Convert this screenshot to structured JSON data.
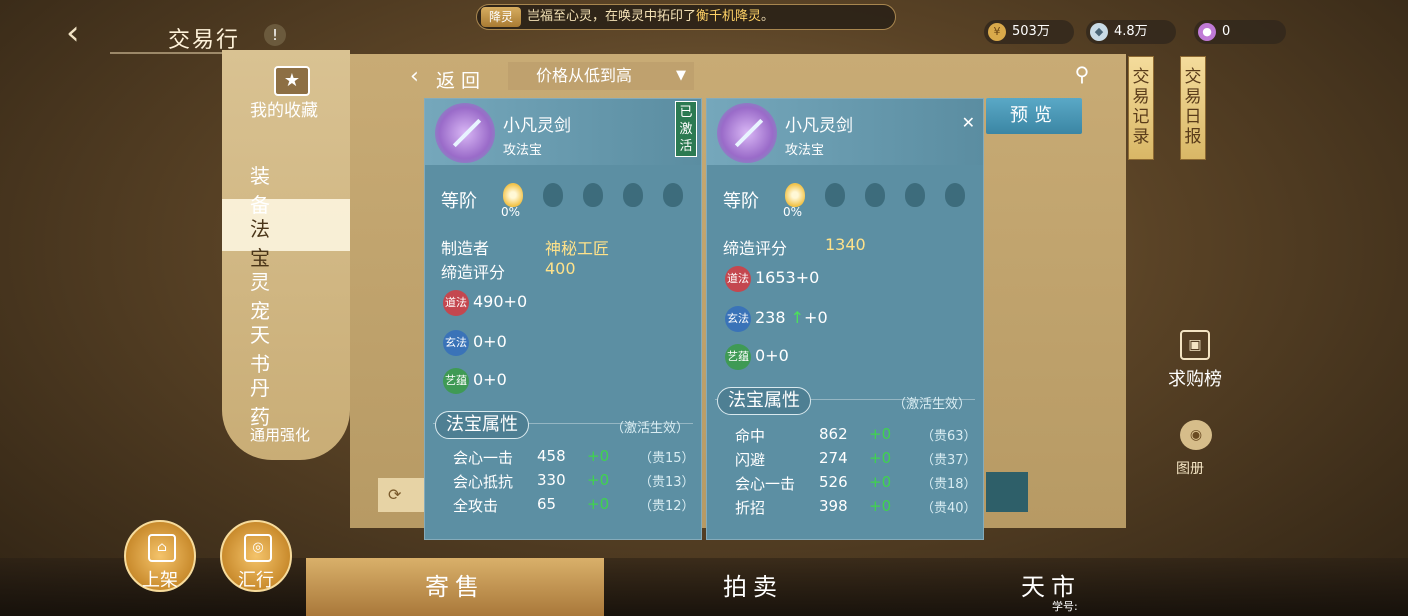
{
  "header": {
    "title": "交易行",
    "badge": "!",
    "ticker_tag": "降灵",
    "ticker_text_a": "岂福至心灵，在唤灵中拓印了",
    "ticker_highlight": "衡千机降灵",
    "ticker_text_b": "。",
    "currencies": [
      {
        "icon": "gold-coin-icon",
        "value": "503万"
      },
      {
        "icon": "silver-ingot-icon",
        "value": "4.8万"
      },
      {
        "icon": "spirit-orb-icon",
        "value": "0"
      }
    ]
  },
  "sidebar": {
    "favorites": "我的收藏",
    "categories": [
      "装备",
      "法宝",
      "灵宠",
      "天书",
      "丹药"
    ],
    "active_category": "法宝",
    "more": "通用强化"
  },
  "toolbar": {
    "back": "返回",
    "sort_value": "价格从低到高",
    "preview": "预览",
    "trade_records": "交易记录",
    "trade_daily": "交易日报"
  },
  "side_actions": {
    "wanted": "求购榜",
    "partial_label": "图册"
  },
  "cards": [
    {
      "name": "小凡灵剑",
      "type": "攻法宝",
      "activated": "已激活",
      "grade_label": "等阶",
      "grade_pct": "0%",
      "info": [
        {
          "k": "制造者",
          "v": "神秘工匠"
        },
        {
          "k": "缔造评分",
          "v": "400"
        }
      ],
      "stats": [
        {
          "gem": "道法",
          "value": "490+0",
          "color": "#c4474f"
        },
        {
          "gem": "玄法",
          "value": "0+0",
          "color": "#3a73b8"
        },
        {
          "gem": "艺蕴",
          "value": "0+0",
          "color": "#3f9a55"
        }
      ],
      "prop_title": "法宝属性",
      "prop_note": "（激活生效）",
      "props": [
        {
          "n": "会心一击",
          "v": "458",
          "b": "+0",
          "p": "（贵15）"
        },
        {
          "n": "会心抵抗",
          "v": "330",
          "b": "+0",
          "p": "（贵13）"
        },
        {
          "n": "全攻击",
          "v": "65",
          "b": "+0",
          "p": "（贵12）"
        }
      ]
    },
    {
      "name": "小凡灵剑",
      "type": "攻法宝",
      "grade_label": "等阶",
      "grade_pct": "0%",
      "info": [
        {
          "k": "缔造评分",
          "v": "1340"
        }
      ],
      "stats": [
        {
          "gem": "道法",
          "value": "1653+0",
          "color": "#c4474f"
        },
        {
          "gem": "玄法",
          "value": "238",
          "up": "↑",
          "extra": "+0",
          "color": "#3a73b8"
        },
        {
          "gem": "艺蕴",
          "value": "0+0",
          "color": "#3f9a55"
        }
      ],
      "prop_title": "法宝属性",
      "prop_note": "（激活生效）",
      "props": [
        {
          "n": "命中",
          "v": "862",
          "b": "+0",
          "p": "（贵63）"
        },
        {
          "n": "闪避",
          "v": "274",
          "b": "+0",
          "p": "（贵37）"
        },
        {
          "n": "会心一击",
          "v": "526",
          "b": "+0",
          "p": "（贵18）"
        },
        {
          "n": "折招",
          "v": "398",
          "b": "+0",
          "p": "（贵40）"
        }
      ]
    }
  ],
  "bottom": {
    "tabs": [
      "寄售",
      "拍卖",
      "天市"
    ],
    "active_tab": "寄售",
    "round_buttons": [
      "上架",
      "汇行"
    ],
    "uid_label": "学号:"
  }
}
